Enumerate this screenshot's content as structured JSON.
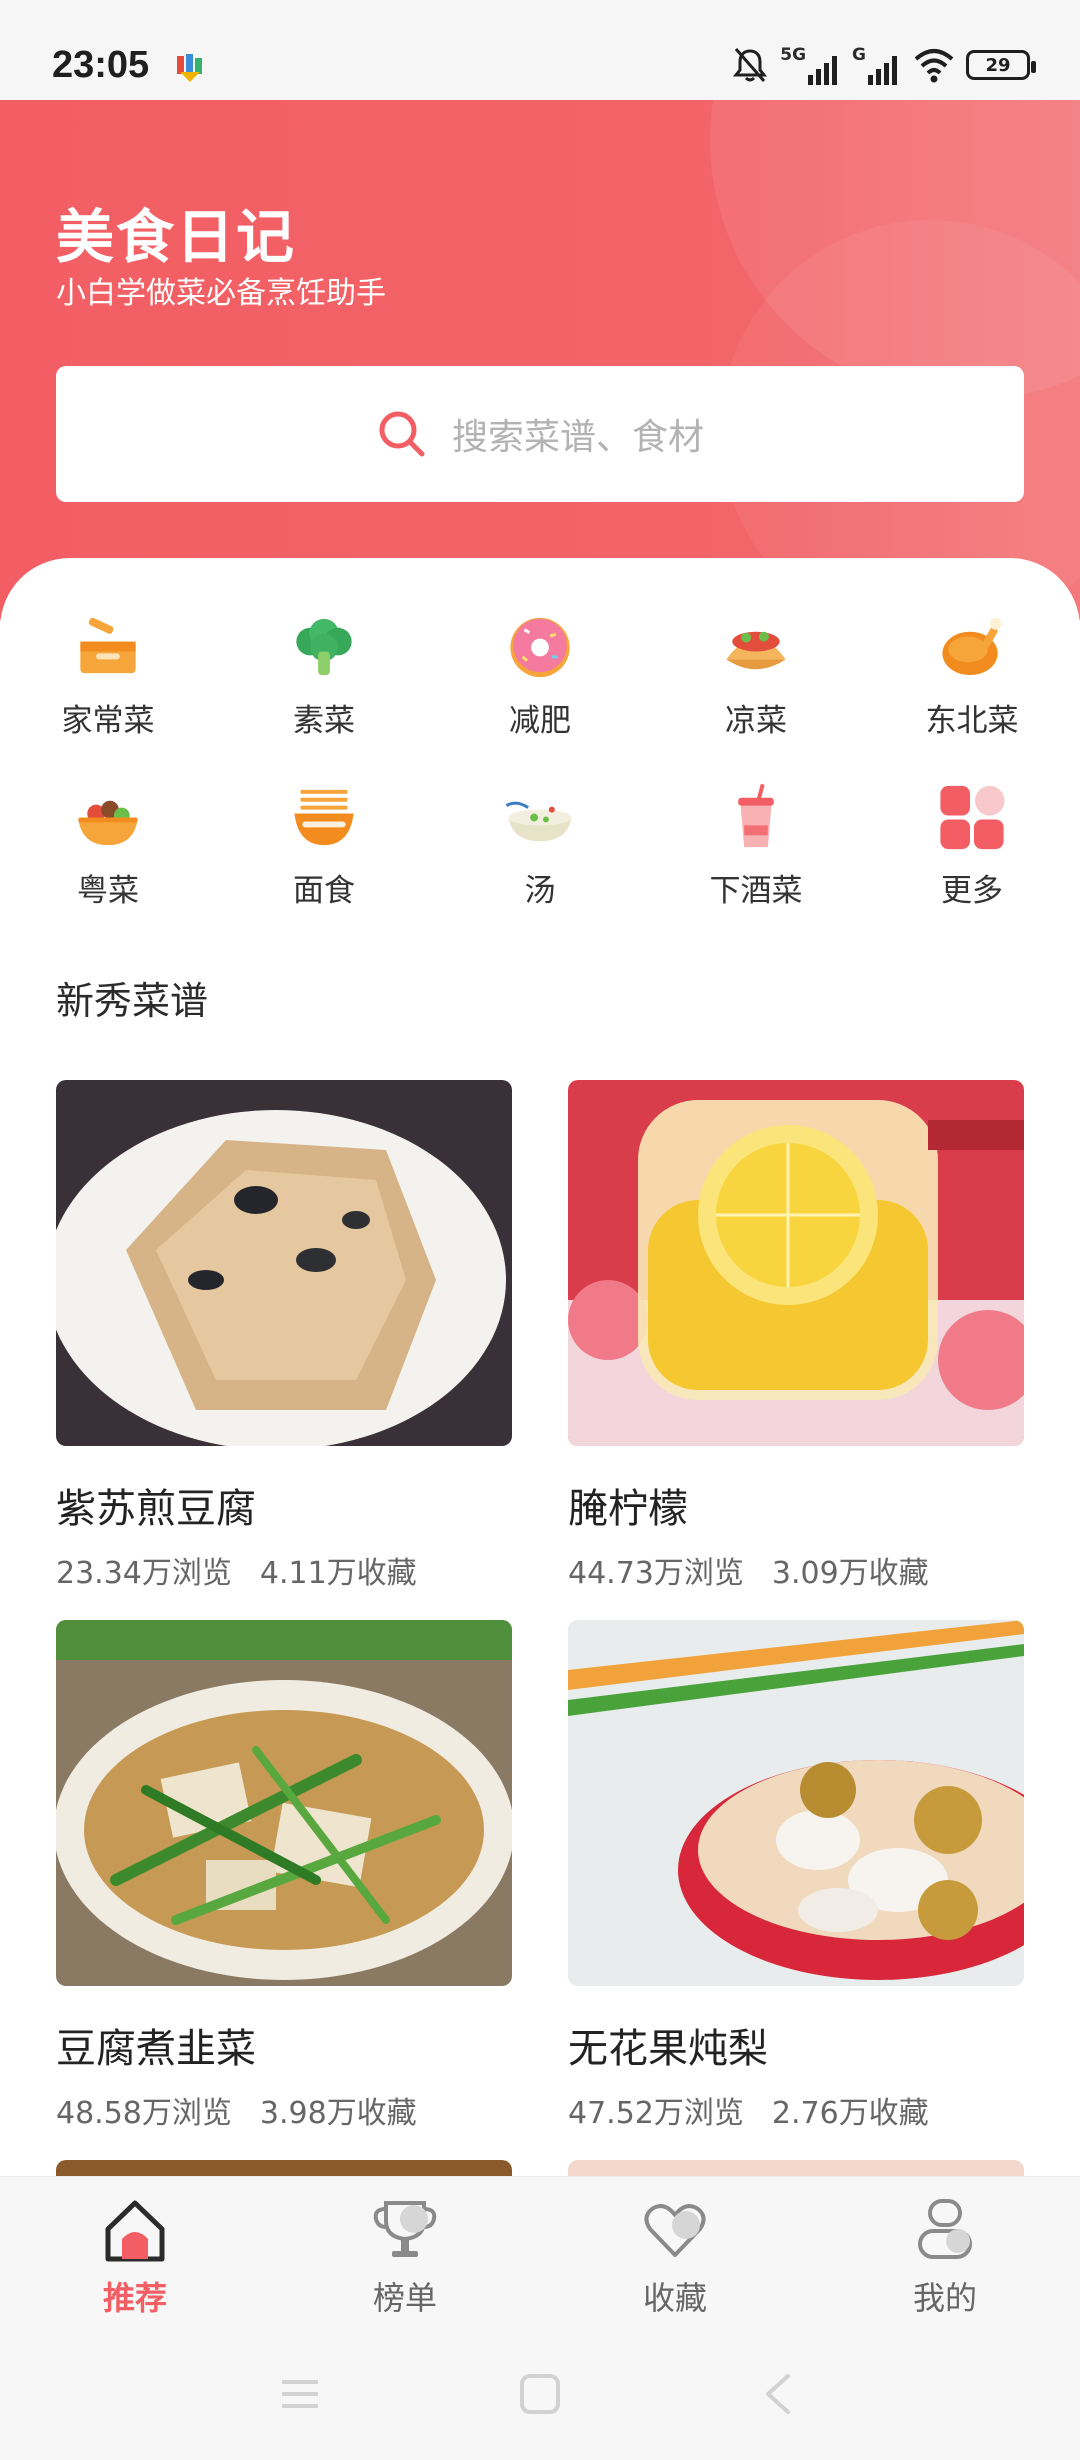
{
  "status_bar": {
    "time": "23:05",
    "network_1": "5G",
    "network_2": "G",
    "battery": "29"
  },
  "header": {
    "title": "美食日记",
    "subtitle": "小白学做菜必备烹饪助手",
    "search_placeholder": "搜索菜谱、食材"
  },
  "categories": [
    {
      "label": "家常菜",
      "icon": "basket-icon"
    },
    {
      "label": "素菜",
      "icon": "broccoli-icon"
    },
    {
      "label": "减肥",
      "icon": "donut-icon"
    },
    {
      "label": "凉菜",
      "icon": "taco-icon"
    },
    {
      "label": "东北菜",
      "icon": "roast-chicken-icon"
    },
    {
      "label": "粤菜",
      "icon": "bowl-dish-icon"
    },
    {
      "label": "面食",
      "icon": "noodle-bowl-icon"
    },
    {
      "label": "汤",
      "icon": "soup-icon"
    },
    {
      "label": "下酒菜",
      "icon": "drink-icon"
    },
    {
      "label": "更多",
      "icon": "grid-more-icon"
    }
  ],
  "section": {
    "title": "新秀菜谱"
  },
  "recipes": [
    {
      "name": "紫苏煎豆腐",
      "views": "23.34万浏览",
      "favorites": "4.11万收藏"
    },
    {
      "name": "腌柠檬",
      "views": "44.73万浏览",
      "favorites": "3.09万收藏"
    },
    {
      "name": "豆腐煮韭菜",
      "views": "48.58万浏览",
      "favorites": "3.98万收藏"
    },
    {
      "name": "无花果炖梨",
      "views": "47.52万浏览",
      "favorites": "2.76万收藏"
    }
  ],
  "bottom_nav": [
    {
      "label": "推荐",
      "active": true
    },
    {
      "label": "榜单",
      "active": false
    },
    {
      "label": "收藏",
      "active": false
    },
    {
      "label": "我的",
      "active": false
    }
  ],
  "colors": {
    "accent": "#f25e63",
    "text_primary": "#222222",
    "text_secondary": "#666666"
  }
}
